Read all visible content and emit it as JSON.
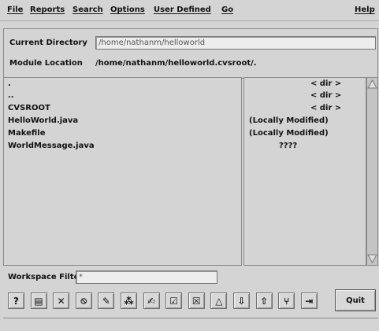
{
  "menu": {
    "items": [
      "File",
      "Reports",
      "Search",
      "Options",
      "User Defined",
      "Go",
      "Help"
    ]
  },
  "header": {
    "current_directory_label": "Current Directory",
    "current_directory_value": "/home/nathanm/helloworld",
    "module_location_label": "Module Location",
    "module_location_value": "/home/nathanm/helloworld.cvsroot/."
  },
  "files": {
    "rows": [
      {
        "name": ".",
        "status": "< dir >"
      },
      {
        "name": "..",
        "status": "< dir >"
      },
      {
        "name": "CVSROOT",
        "status": "< dir >"
      },
      {
        "name": "HelloWorld.java",
        "status": "(Locally Modified)"
      },
      {
        "name": "Makefile",
        "status": "(Locally Modified)"
      },
      {
        "name": "WorldMessage.java",
        "status": "????"
      }
    ]
  },
  "filter": {
    "label": "Workspace Filter:",
    "value": "*"
  },
  "toolbar": {
    "buttons": [
      {
        "name": "help-icon",
        "glyph": "?"
      },
      {
        "name": "list-icon",
        "glyph": "▤"
      },
      {
        "name": "delete-icon",
        "glyph": "✕"
      },
      {
        "name": "no-icon",
        "glyph": "⦸"
      },
      {
        "name": "edit-icon",
        "glyph": "✎"
      },
      {
        "name": "log-icon",
        "glyph": "⁂"
      },
      {
        "name": "annotate-icon",
        "glyph": "✍"
      },
      {
        "name": "check-icon",
        "glyph": "☑"
      },
      {
        "name": "remove-icon",
        "glyph": "☒"
      },
      {
        "name": "delta-icon",
        "glyph": "△"
      },
      {
        "name": "checkout-icon",
        "glyph": "⇩"
      },
      {
        "name": "commit-icon",
        "glyph": "⇧"
      },
      {
        "name": "branch-icon",
        "glyph": "⑂"
      },
      {
        "name": "merge-icon",
        "glyph": "⇥"
      }
    ],
    "quit_label": "Quit"
  }
}
